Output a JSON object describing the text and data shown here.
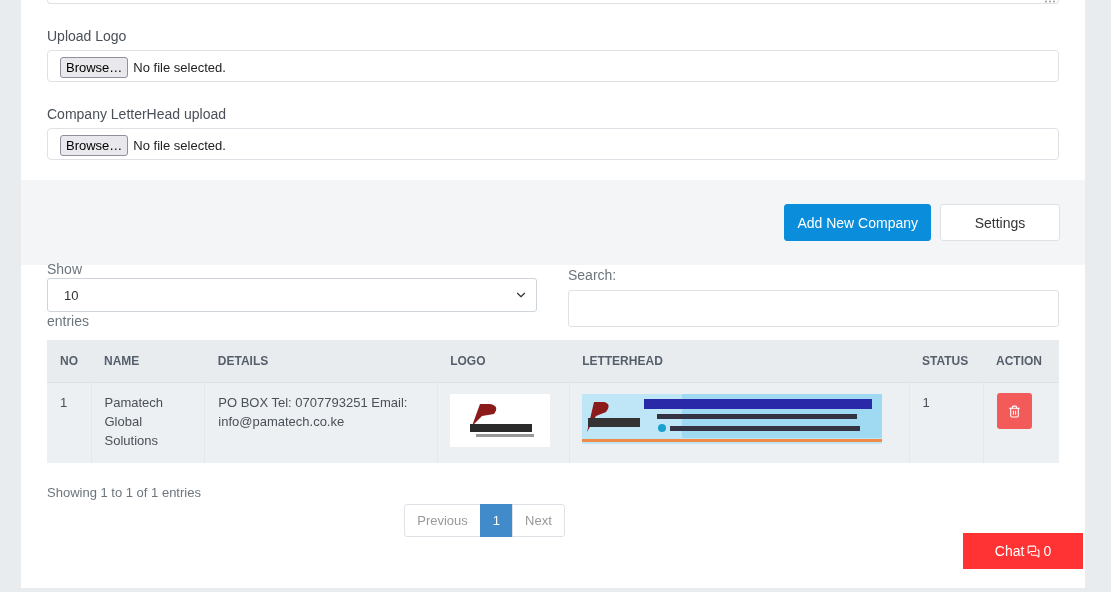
{
  "uploads": [
    {
      "label": "Upload Logo",
      "button": "Browse…",
      "status": "No file selected."
    },
    {
      "label": "Company LetterHead upload",
      "button": "Browse…",
      "status": "No file selected."
    }
  ],
  "actions": [
    {
      "label": "Add New Company",
      "kind": "primary"
    },
    {
      "label": "Settings",
      "kind": "secondary"
    }
  ],
  "length": {
    "before": "Show",
    "value": "10",
    "after": "entries"
  },
  "search": {
    "label": "Search:"
  },
  "table": {
    "columns": [
      "NO",
      "NAME",
      "DETAILS",
      "LOGO",
      "LETTERHEAD",
      "STATUS",
      "ACTION"
    ],
    "rows": [
      {
        "no": "1",
        "name": "Pamatech Global Solutions",
        "details": "PO BOX Tel: 0707793251 Email: info@pamatech.co.ke",
        "status": "1"
      }
    ]
  },
  "info": "Showing 1 to 1 of 1 entries",
  "pagination": [
    {
      "label": "Previous",
      "selected": false,
      "disabled": true
    },
    {
      "label": "1",
      "selected": true,
      "disabled": false
    },
    {
      "label": "Next",
      "selected": false,
      "disabled": true
    }
  ],
  "chat": {
    "label": "Chat",
    "count": "0"
  }
}
